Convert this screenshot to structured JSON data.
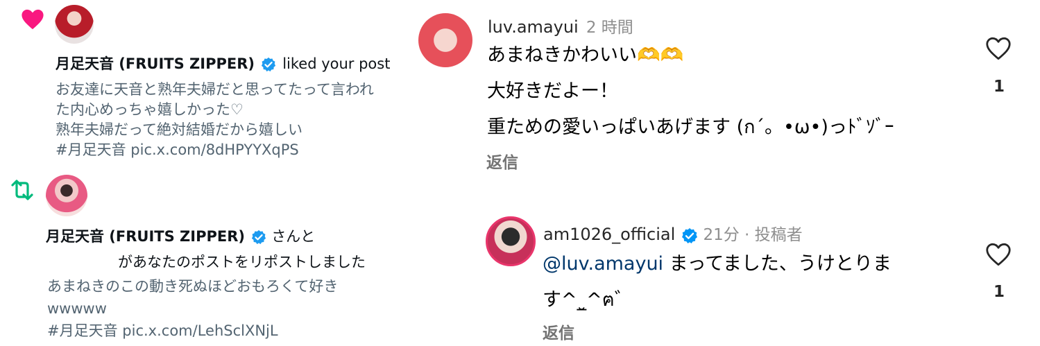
{
  "notif_like": {
    "name": "月足天音 (FRUITS ZIPPER)",
    "action": "liked your post",
    "lines": [
      "お友達に天音と熟年夫婦だと思ってたって言われ",
      "た内心めっちゃ嬉しかった♡",
      "熟年夫婦だって絶対結婚だから嬉しい"
    ],
    "tag": " #月足天音 ",
    "link": "pic.x.com/8dHPYYXqPS"
  },
  "notif_repost": {
    "name": "月足天音 (FRUITS ZIPPER)",
    "action_1": "さんと",
    "action_2": "があなたのポストをリポストしました",
    "lines": [
      "あまねきのこの動き死ぬほどおもろくて好き",
      "wwwww"
    ],
    "tag": " #月足天音 ",
    "link": "pic.x.com/LehSclXNjL"
  },
  "comment_1": {
    "username": "luv.amayui",
    "time": "2 時間",
    "lines": [
      "あまねきかわいい🫶🫶",
      "大好きだよー！",
      "重ための愛いっぱいあげます (ก´。•ω•)っﾄﾞｿﾞｰ"
    ],
    "reply": "返信",
    "like_count": "1"
  },
  "comment_2": {
    "username": "am1026_official",
    "time": "21分 · 投稿者",
    "mention": "@luv.amayui",
    "text_1": " まってました、うけとりま",
    "text_2": "す^_̮^ฅ゛",
    "reply": "返信",
    "like_count": "1"
  },
  "colors": {
    "heart": "#f91880",
    "repost": "#00ba7c",
    "verified": "#1d9bf0",
    "link": "#1d6ebd"
  }
}
